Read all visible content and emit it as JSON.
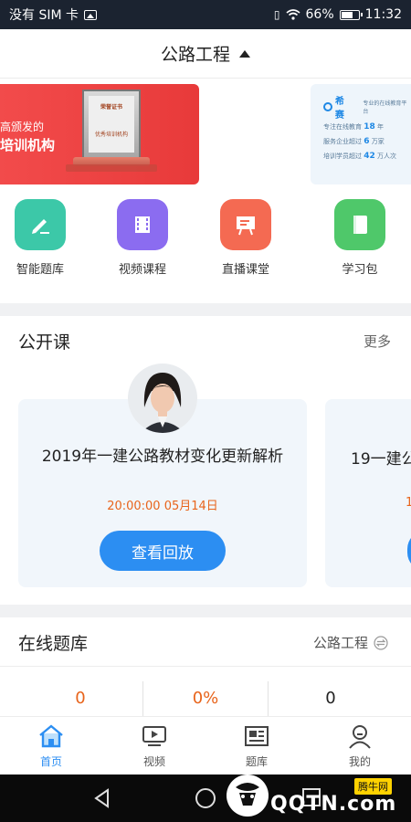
{
  "status_bar": {
    "carrier": "没有 SIM 卡",
    "battery": "66%",
    "time": "11:32"
  },
  "header": {
    "title": "公路工程"
  },
  "banners": {
    "left": {
      "line1": "高颁发的",
      "line2": "培训机构",
      "cert_title": "荣誉证书",
      "cert_text": "优秀培训机构"
    },
    "right": {
      "logo": "希赛",
      "tagline": "专业的在线教育平台",
      "items": [
        {
          "prefix": "专注在线教育",
          "value": "18",
          "suffix": "年"
        },
        {
          "prefix": "服务企业超过",
          "value": "6",
          "suffix": "万家"
        },
        {
          "prefix": "培训学员超过",
          "value": "42",
          "suffix": "万人次"
        }
      ]
    }
  },
  "nav": [
    {
      "label": "智能题库",
      "icon": "pencil-icon",
      "color": "#3cc8a8"
    },
    {
      "label": "视频课程",
      "icon": "film-icon",
      "color": "#8b6cf0"
    },
    {
      "label": "直播课堂",
      "icon": "live-board-icon",
      "color": "#f46a52"
    },
    {
      "label": "学习包",
      "icon": "book-icon",
      "color": "#4fc86a"
    }
  ],
  "open_course": {
    "title": "公开课",
    "more": "更多",
    "cards": [
      {
        "title": "2019年一建公路教材变化更新解析",
        "time": "20:00:00  05月14日",
        "button": "查看回放"
      },
      {
        "title": "19一建公",
        "time": "1"
      }
    ]
  },
  "online_bank": {
    "title": "在线题库",
    "filter": "公路工程",
    "stats": [
      {
        "value": "0",
        "color": "#e8641b"
      },
      {
        "value": "0%",
        "color": "#e8641b"
      },
      {
        "value": "0",
        "color": "#222222"
      }
    ]
  },
  "tabs": [
    {
      "label": "首页",
      "icon": "home-icon",
      "active": true
    },
    {
      "label": "视频",
      "icon": "video-icon",
      "active": false
    },
    {
      "label": "题库",
      "icon": "question-bank-icon",
      "active": false
    },
    {
      "label": "我的",
      "icon": "profile-icon",
      "active": false
    }
  ],
  "watermark": {
    "text": "QQTN.com",
    "tag": "腾牛网"
  },
  "colors": {
    "accent": "#2c8ef2",
    "highlight": "#e8641b"
  }
}
